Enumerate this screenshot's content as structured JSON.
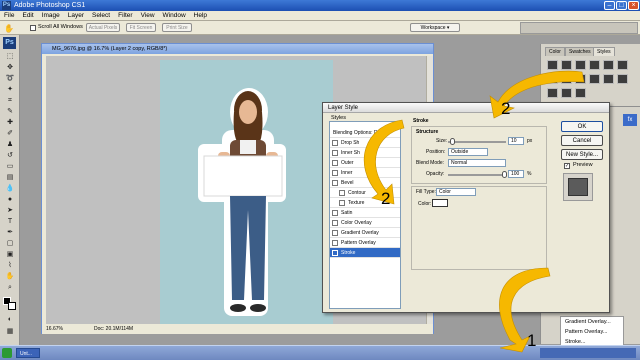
{
  "app": {
    "title": "Adobe Photoshop CS1",
    "logo": "Ps"
  },
  "menu": [
    "File",
    "Edit",
    "Image",
    "Layer",
    "Select",
    "Filter",
    "View",
    "Window",
    "Help"
  ],
  "options": {
    "scroll_all": "Scroll All Windows",
    "buttons": [
      "Actual Pixels",
      "Fit Screen",
      "Print Size"
    ],
    "workspace": "Workspace ▾"
  },
  "document": {
    "title": "MG_9676.jpg @ 16.7% (Layer 2 copy, RGB/8*)",
    "zoom": "16.67%",
    "doc_info": "Doc: 20.1M/114M"
  },
  "dialog": {
    "title": "Layer Style",
    "styles_header": "Styles",
    "blending": "Blending Options: Default",
    "items": [
      "Drop Shadow",
      "Inner Shadow",
      "Outer Glow",
      "Inner Glow",
      "Bevel and Emboss",
      "Contour",
      "Texture",
      "Satin",
      "Color Overlay",
      "Gradient Overlay",
      "Pattern Overlay",
      "Stroke"
    ],
    "item_labels": [
      "Drop Sh",
      "Inner Sh",
      "Outer",
      "Inner",
      "Bevel",
      "Contour",
      "Texture",
      "Satin",
      "Color Overlay",
      "Gradient Overlay",
      "Pattern Overlay",
      "Stroke"
    ],
    "panel_title": "Stroke",
    "structure": "Structure",
    "size_label": "Size:",
    "size_value": "10",
    "size_unit": "px",
    "position_label": "Position:",
    "position_value": "Outside",
    "blend_label": "Blend Mode:",
    "blend_value": "Normal",
    "opacity_label": "Opacity:",
    "opacity_value": "100",
    "opacity_unit": "%",
    "fill_type_label": "Fill Type:",
    "fill_type_value": "Color",
    "color_label": "Color:",
    "ok": "OK",
    "cancel": "Cancel",
    "new_style": "New Style...",
    "preview": "Preview"
  },
  "right_panel": {
    "tabs": [
      "Color",
      "Swatches",
      "Styles"
    ]
  },
  "context_menu": [
    "Gradient Overlay...",
    "Pattern Overlay...",
    "Stroke..."
  ],
  "annotations": {
    "n1": "1",
    "n2": "2",
    "n3": "2"
  },
  "taskbar": {
    "item": "Unt..."
  },
  "colors": {
    "arrow": "#f6b800",
    "canvas_bg": "#a8ccd1",
    "selection": "#316ac5"
  }
}
